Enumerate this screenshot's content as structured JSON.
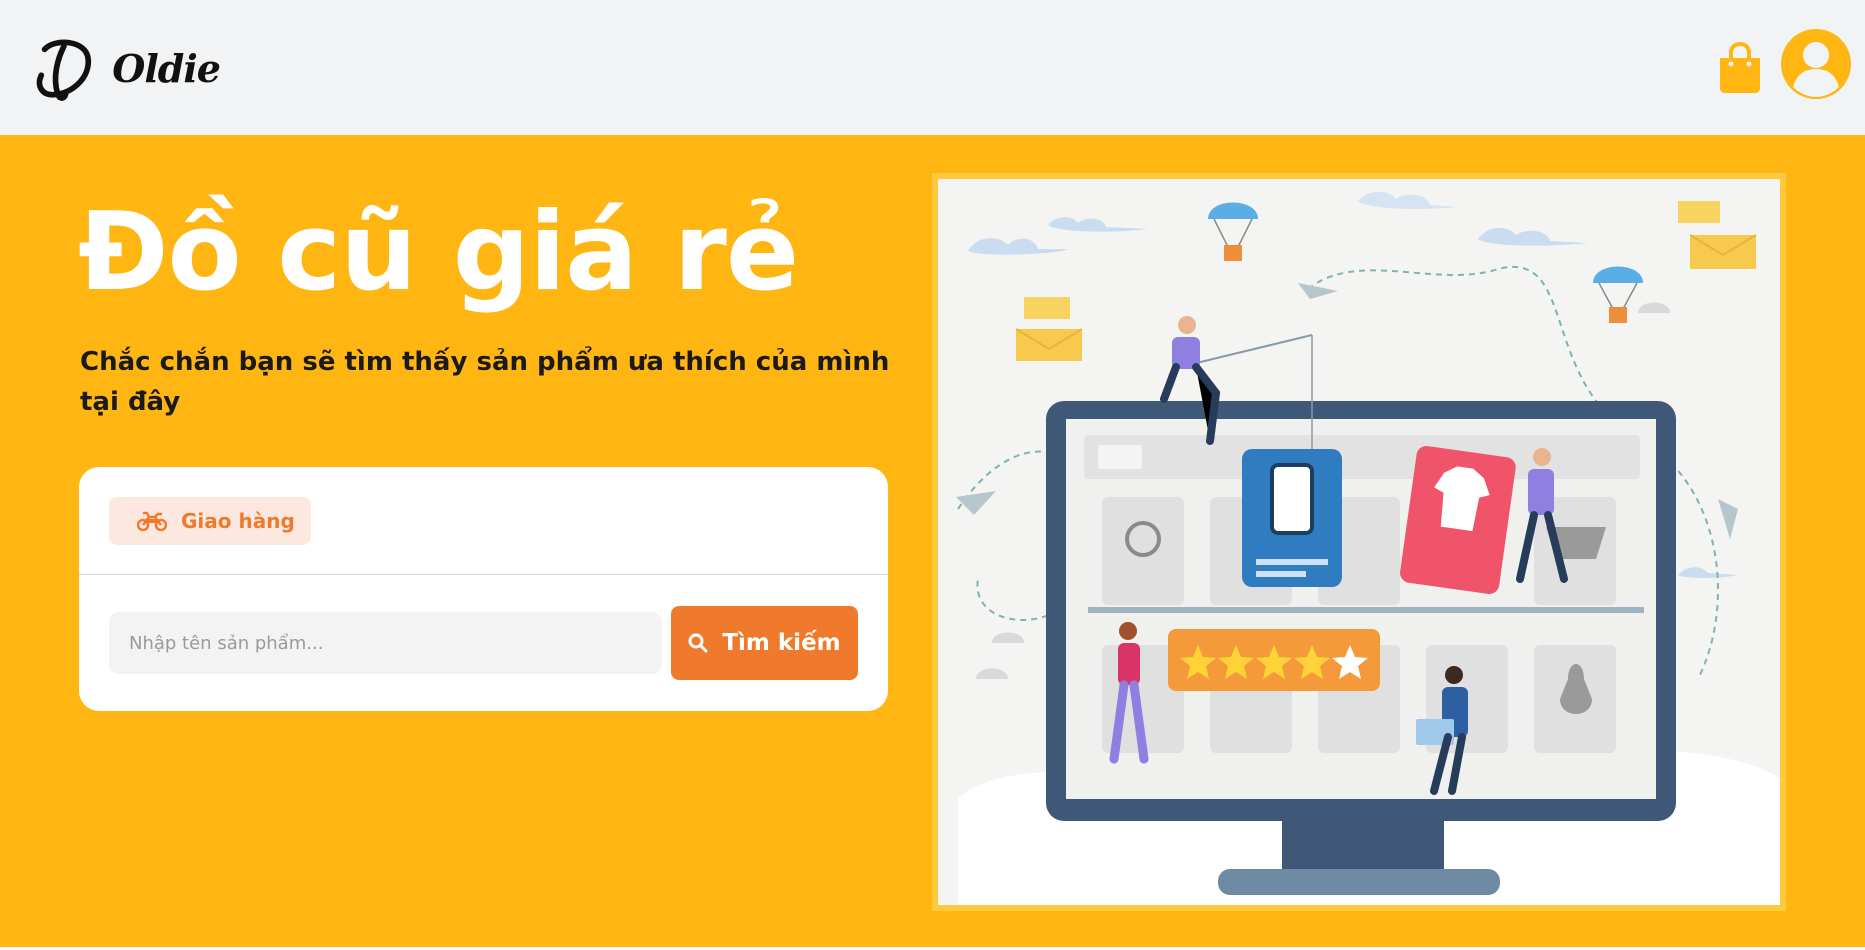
{
  "header": {
    "brand_name": "Oldie",
    "brand_letter": "O",
    "logo_icon": "oldie-logo-icon",
    "cart_icon": "shopping-bag-icon",
    "account_icon": "user-avatar-icon"
  },
  "hero": {
    "title": "Đồ cũ giá rẻ",
    "subtitle": "Chắc chắn bạn sẽ tìm thấy sản phẩm ưa thích của mình tại đây",
    "illustration_icon": "online-shopping-illustration"
  },
  "search": {
    "tab_label": "Giao hàng",
    "tab_icon": "motorbike-icon",
    "input_placeholder": "Nhập tên sản phẩm...",
    "input_value": "",
    "button_label": "Tìm kiếm",
    "button_icon": "search-icon"
  },
  "colors": {
    "brand_yellow": "#ffb512",
    "accent_orange": "#f07a2c",
    "header_bg": "#f2f3f4",
    "tab_bg": "#fde8e0"
  }
}
